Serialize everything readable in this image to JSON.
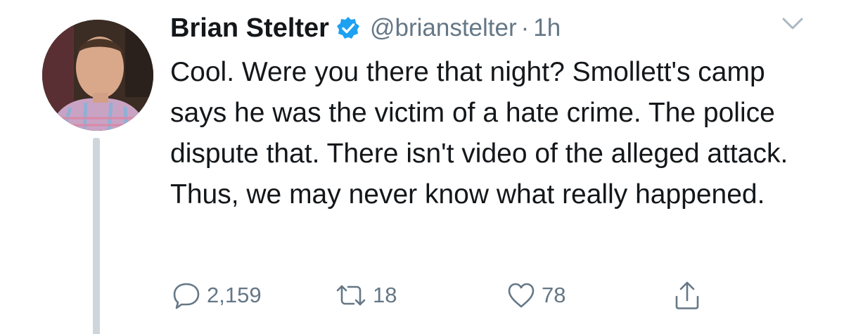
{
  "author": {
    "name": "Brian Stelter",
    "handle": "@brianstelter",
    "separator": "·",
    "time": "1h",
    "verified": true
  },
  "tweet": {
    "text": "Cool. Were you there that night? Smollett's camp says he was the victim of a hate crime. The police dispute that. There isn't video of the alleged attack. Thus, we may never know what really happened."
  },
  "actions": {
    "reply_count": "2,159",
    "retweet_count": "18",
    "like_count": "78"
  },
  "icons": {
    "verified": "verified-badge-icon",
    "caret": "chevron-down-icon",
    "reply": "reply-icon",
    "retweet": "retweet-icon",
    "like": "heart-icon",
    "share": "share-icon"
  },
  "colors": {
    "text": "#14171a",
    "secondary": "#657786",
    "verified": "#1da1f2",
    "thread_line": "#cfd6db"
  }
}
